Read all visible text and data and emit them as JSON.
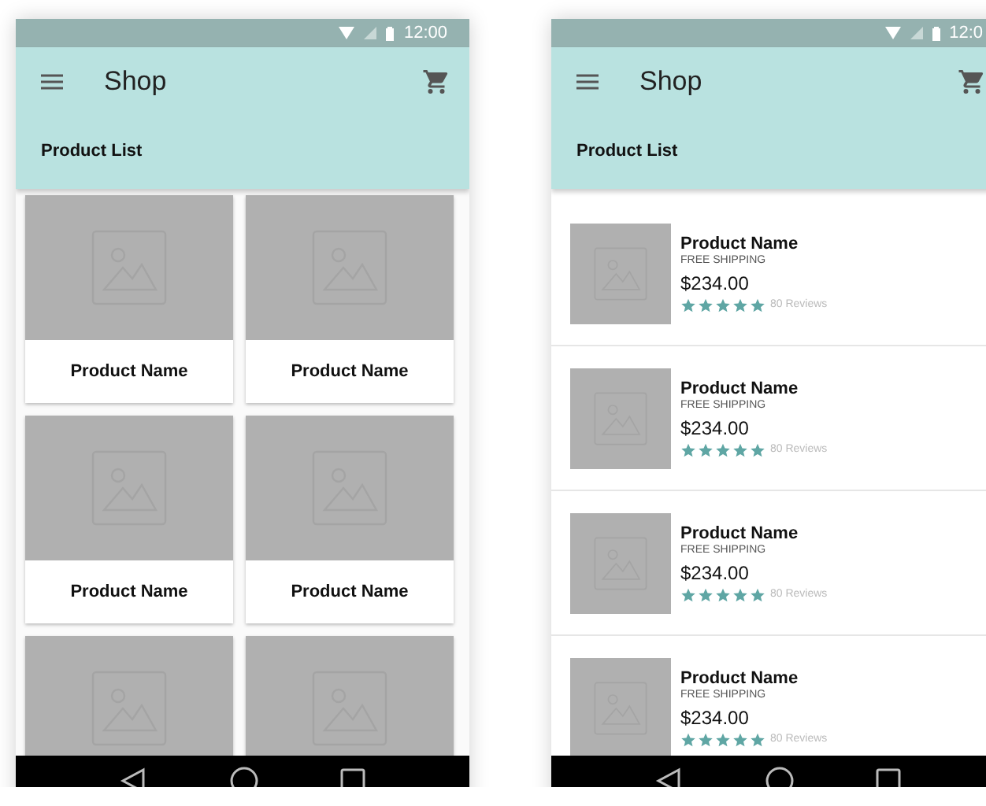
{
  "phones": [
    {
      "status": {
        "time": "12:00"
      },
      "toolbar": {
        "title": "Shop",
        "subtitle": "Product List"
      },
      "kind": "grid",
      "products": [
        {
          "kind": "card",
          "name": "Product Name"
        },
        {
          "kind": "card",
          "name": "Product Name"
        },
        {
          "kind": "card",
          "name": "Product Name"
        },
        {
          "kind": "card",
          "name": "Product Name"
        },
        {
          "kind": "picture"
        },
        {
          "kind": "picture"
        }
      ]
    },
    {
      "status": {
        "time": "12:0"
      },
      "toolbar": {
        "title": "Shop",
        "subtitle": "Product List"
      },
      "kind": "list",
      "products": [
        {
          "name": "Product Name",
          "shipping": "FREE SHIPPING",
          "price": "$234.00",
          "stars": 5,
          "reviews": "80 Reviews"
        },
        {
          "name": "Product Name",
          "shipping": "FREE SHIPPING",
          "price": "$234.00",
          "stars": 5,
          "reviews": "80 Reviews"
        },
        {
          "name": "Product Name",
          "shipping": "FREE SHIPPING",
          "price": "$234.00",
          "stars": 5,
          "reviews": "80 Reviews"
        },
        {
          "name": "Product Name",
          "shipping": "FREE SHIPPING",
          "price": "$234.00",
          "stars": 5,
          "reviews": "80 Reviews"
        }
      ]
    }
  ]
}
